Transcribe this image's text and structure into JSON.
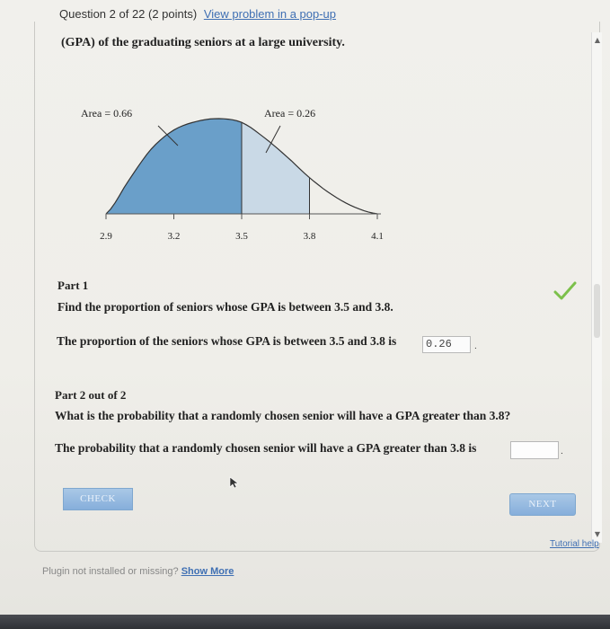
{
  "header": {
    "question_label": "Question 2 of 22 (2 points)",
    "popup_link": "View problem in a pop-up"
  },
  "problem": {
    "intro": "(GPA) of the graduating seniors at a large university."
  },
  "chart_data": {
    "type": "area",
    "x_ticks": [
      "2.9",
      "3.2",
      "3.5",
      "3.8",
      "4.1"
    ],
    "xlim": [
      2.9,
      4.1
    ],
    "regions": [
      {
        "label": "Area = 0.66",
        "from": 2.9,
        "to": 3.5,
        "area": 0.66,
        "color": "#6a9fc9"
      },
      {
        "label": "Area = 0.26",
        "from": 3.5,
        "to": 3.8,
        "area": 0.26,
        "color": "#c9d9e6"
      }
    ],
    "curve": {
      "x": [
        2.9,
        3.0,
        3.1,
        3.2,
        3.3,
        3.4,
        3.5,
        3.6,
        3.7,
        3.8,
        3.9,
        4.0,
        4.1
      ],
      "y": [
        0.0,
        0.35,
        0.68,
        0.88,
        0.97,
        1.0,
        0.96,
        0.8,
        0.6,
        0.38,
        0.2,
        0.07,
        0.0
      ]
    }
  },
  "part1": {
    "title": "Part 1",
    "question": "Find the proportion of seniors whose GPA is between 3.5 and 3.8.",
    "answer_text": "The proportion of the seniors whose GPA is between 3.5 and 3.8 is",
    "answer_value": "0.26",
    "status_icon": "checkmark-icon",
    "status_color": "#7cc04b"
  },
  "part2": {
    "title": "Part 2 out of 2",
    "question": "What is the probability that a randomly chosen senior will have a GPA greater than 3.8?",
    "answer_text": "The probability that a randomly chosen senior will have a GPA greater than 3.8 is",
    "answer_value": ""
  },
  "buttons": {
    "check": "CHECK",
    "next": "NEXT"
  },
  "tutorial_link": "Tutorial help",
  "plugin": {
    "message": "Plugin not installed or missing?",
    "link": "Show More"
  },
  "colors": {
    "accent_link": "#3f6fb3",
    "button": "#86aedb"
  }
}
